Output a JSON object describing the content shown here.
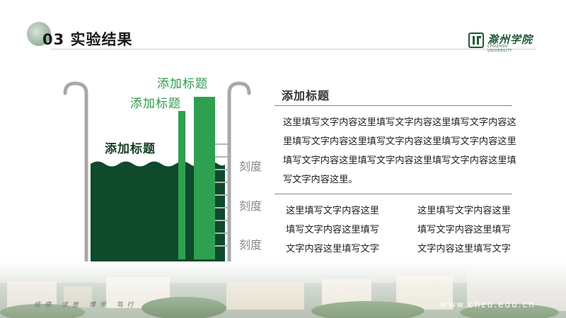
{
  "header": {
    "section_number": "03",
    "title": "实验结果",
    "logo_name": "滁州学院",
    "logo_sub": "CHUZHOU UNIVERSITY"
  },
  "beaker": {
    "label_top": "添加标题",
    "label_mid": "添加标题",
    "label_water": "添加标题",
    "tick_labels": [
      "刻度",
      "刻度",
      "刻度"
    ],
    "colors": {
      "water": "#0e4a2b",
      "bars": "#2ea050",
      "glass": "#a8a8a8"
    }
  },
  "content": {
    "section_title": "添加标题",
    "paragraph": "这里填写文字内容这里填写文字内容这里填写文字内容这里填写文字内容这里填写文字内容这里填写文字内容这里填写文字内容这里填写文字内容这里填写文字内容这里填写文字内容这里。",
    "left_column": "这里填写文字内容这里填写文字内容这里填写文字内容这里填写文字内容",
    "right_column": "这里填写文字内容这里填写文字内容这里填写文字内容这里填写文字内容"
  },
  "footer": {
    "motto": "修德 求是 博学 笃行",
    "website": "www.chzu.edu.cn"
  }
}
